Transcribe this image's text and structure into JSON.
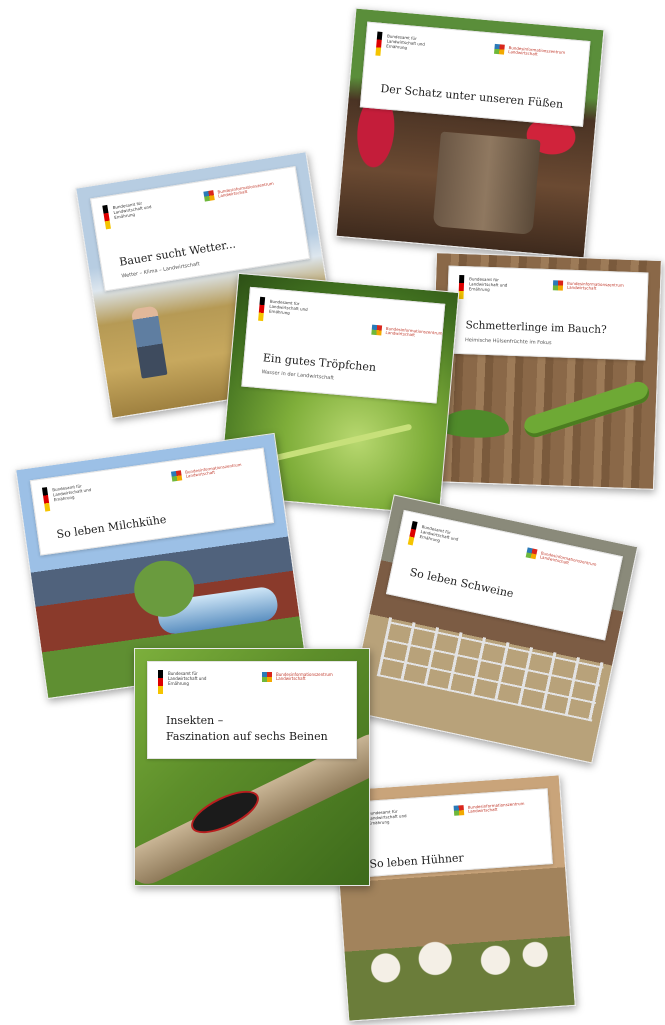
{
  "heading_fragment": "at",
  "cards": [
    {
      "title": "Der Schatz unter unseren Füßen",
      "subtitle": ""
    },
    {
      "title": "Bauer sucht Wetter...",
      "subtitle": "Wetter – Klima – Landwirtschaft"
    },
    {
      "title": "Ein gutes Tröpfchen",
      "subtitle": "Wasser in der Landwirtschaft"
    },
    {
      "title": "Schmetterlinge im Bauch?",
      "subtitle": "Heimische Hülsenfrüchte im Fokus"
    },
    {
      "title": "So leben Milchkühe",
      "subtitle": ""
    },
    {
      "title": "So leben Schweine",
      "subtitle": ""
    },
    {
      "title": "Insekten –",
      "title2": "Faszination auf sechs Beinen",
      "subtitle": ""
    },
    {
      "title": "So leben Hühner",
      "subtitle": ""
    }
  ],
  "logos": {
    "ministry_name": "Bundesamt für Landwirtschaft und Ernährung",
    "center_name": "Bundesinformationszentrum Landwirtschaft"
  }
}
